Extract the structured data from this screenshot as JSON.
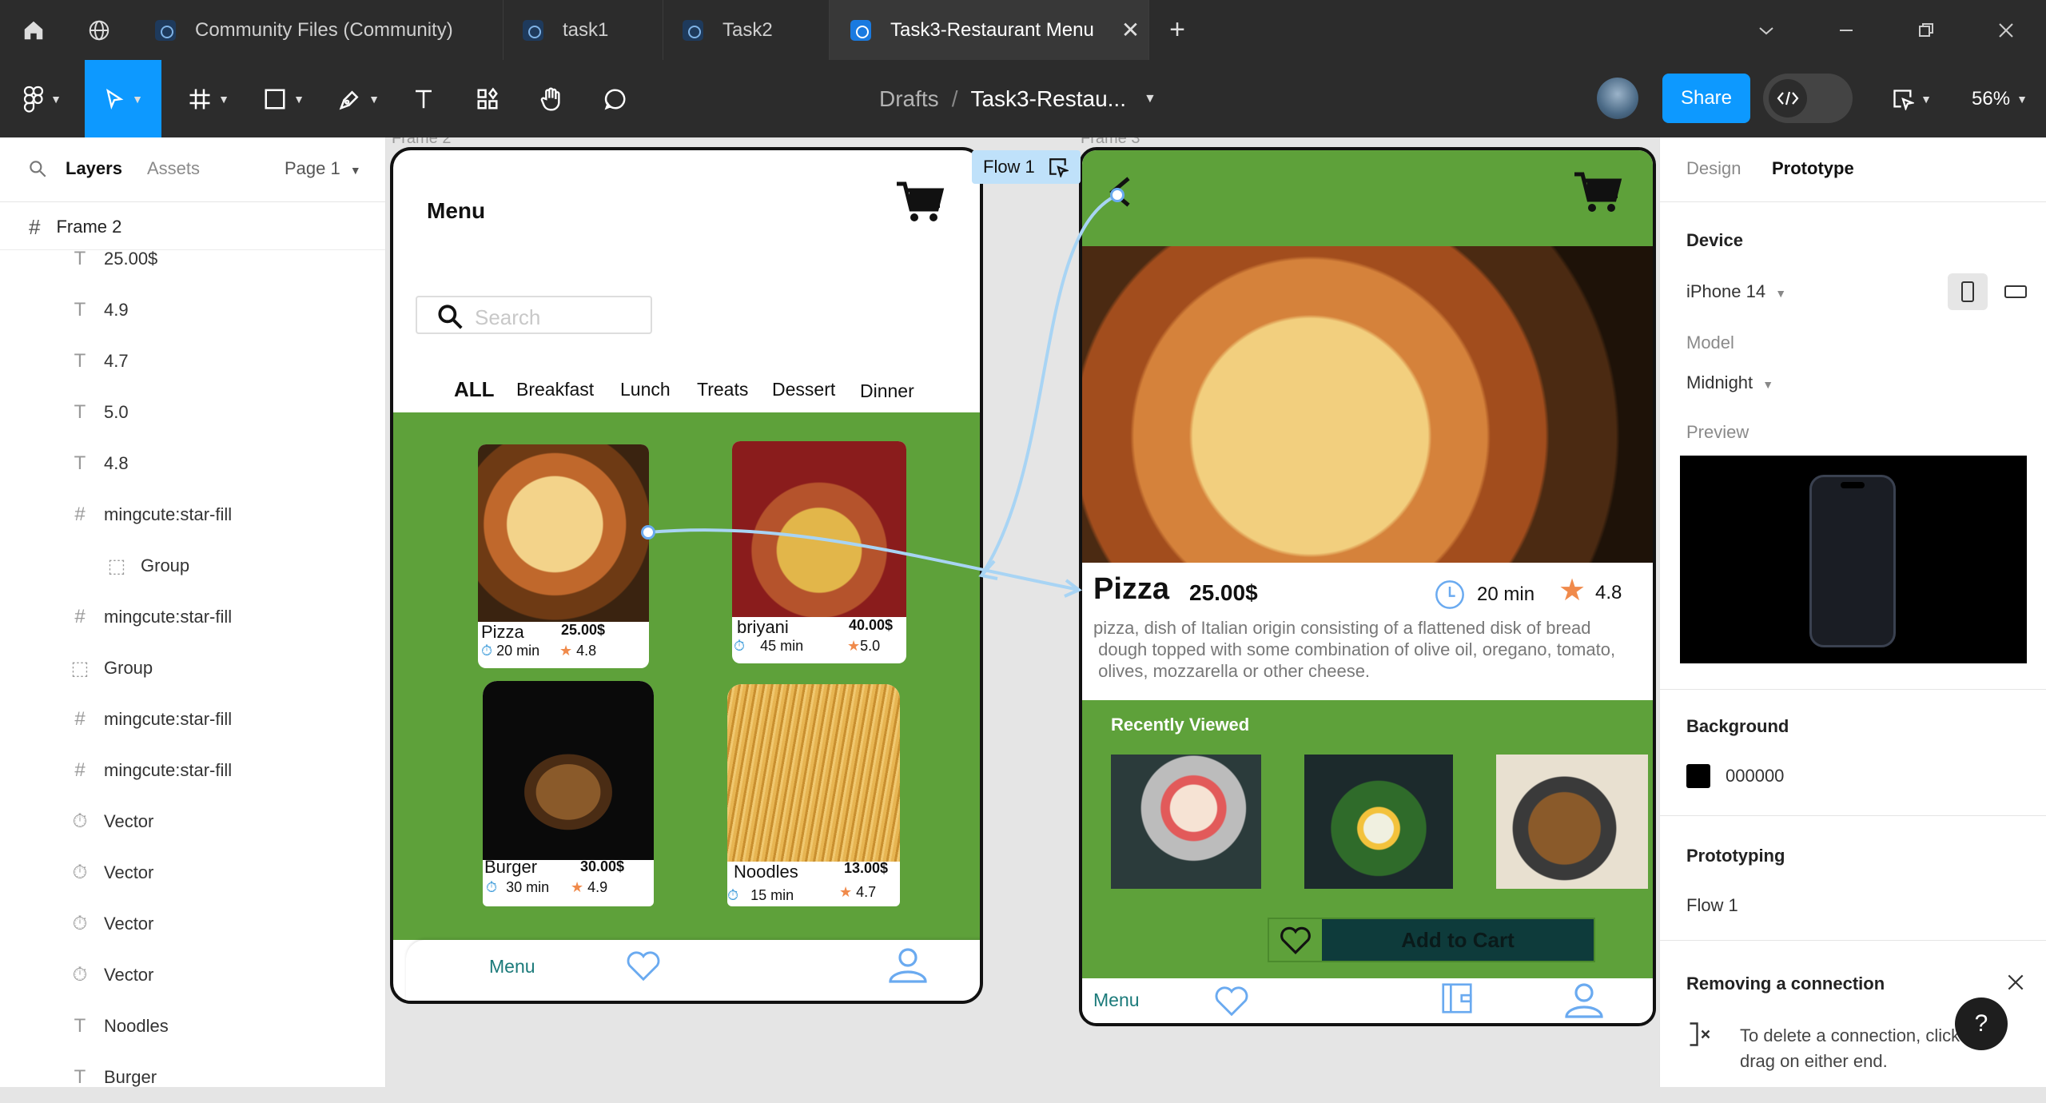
{
  "tabs": {
    "home_icon": "home-icon",
    "globe_icon": "globe-icon",
    "items": [
      {
        "label": "Community Files (Community)"
      },
      {
        "label": "task1"
      },
      {
        "label": "Task2"
      },
      {
        "label": "Task3-Restaurant Menu",
        "active": true
      }
    ],
    "new_tab": "+"
  },
  "toolbar": {
    "breadcrumb_root": "Drafts",
    "breadcrumb_sep": "/",
    "file_name": "Task3-Restau...",
    "share_label": "Share",
    "zoom": "56%"
  },
  "left_panel": {
    "tab_layers": "Layers",
    "tab_assets": "Assets",
    "page": "Page 1",
    "frame": "Frame 2",
    "layers": [
      {
        "type": "text",
        "label": "25.00$"
      },
      {
        "type": "text",
        "label": "4.9"
      },
      {
        "type": "text",
        "label": "4.7"
      },
      {
        "type": "text",
        "label": "5.0"
      },
      {
        "type": "text",
        "label": "4.8"
      },
      {
        "type": "frame",
        "label": "mingcute:star-fill"
      },
      {
        "type": "group",
        "label": "Group",
        "indent": true
      },
      {
        "type": "frame",
        "label": "mingcute:star-fill"
      },
      {
        "type": "group",
        "label": "Group"
      },
      {
        "type": "frame",
        "label": "mingcute:star-fill"
      },
      {
        "type": "frame",
        "label": "mingcute:star-fill"
      },
      {
        "type": "vector",
        "label": "Vector"
      },
      {
        "type": "vector",
        "label": "Vector"
      },
      {
        "type": "vector",
        "label": "Vector"
      },
      {
        "type": "vector",
        "label": "Vector"
      },
      {
        "type": "text",
        "label": "Noodles"
      },
      {
        "type": "text",
        "label": "Burger"
      }
    ]
  },
  "canvas": {
    "frame2_label": "Frame 2",
    "frame3_label": "Frame 3",
    "flow_label": "Flow 1",
    "menu_screen": {
      "title": "Menu",
      "search_placeholder": "Search",
      "categories": [
        "ALL",
        "Breakfast",
        "Lunch",
        "Treats",
        "Dessert",
        "Dinner"
      ],
      "items": [
        {
          "name": "Pizza",
          "price": "25.00$",
          "time": "20 min",
          "rating": "4.8"
        },
        {
          "name": "briyani",
          "price": "40.00$",
          "time": "45 min",
          "rating": "5.0"
        },
        {
          "name": "Burger",
          "price": "30.00$",
          "time": "30 min",
          "rating": "4.9"
        },
        {
          "name": "Noodles",
          "price": "13.00$",
          "time": "15 min",
          "rating": "4.7"
        }
      ],
      "nav_menu": "Menu"
    },
    "detail_screen": {
      "name": "Pizza",
      "price": "25.00$",
      "time": "20 min",
      "rating": "4.8",
      "description_1": "pizza, dish of Italian origin consisting of a flattened disk of bread",
      "description_2": " dough topped with some combination of olive oil, oregano, tomato,",
      "description_3": " olives, mozzarella or other cheese.",
      "recently_viewed": "Recently Viewed",
      "add_to_cart": "Add to Cart",
      "nav_menu": "Menu"
    }
  },
  "right_panel": {
    "tab_design": "Design",
    "tab_prototype": "Prototype",
    "device_heading": "Device",
    "device": "iPhone 14",
    "model_heading": "Model",
    "model": "Midnight",
    "preview_heading": "Preview",
    "background_heading": "Background",
    "background_hex": "000000",
    "prototyping_heading": "Prototyping",
    "flow": "Flow 1",
    "tip_title": "Removing a connection",
    "tip_text_1": "To delete a connection, click and",
    "tip_text_2": "drag on either end.",
    "help": "?"
  },
  "colors": {
    "accent": "#0d99ff",
    "app_green": "#5ea13a",
    "toolbar_bg": "#2c2c2c",
    "star": "#f08a4b",
    "cart_btn": "#0e3b3b"
  }
}
